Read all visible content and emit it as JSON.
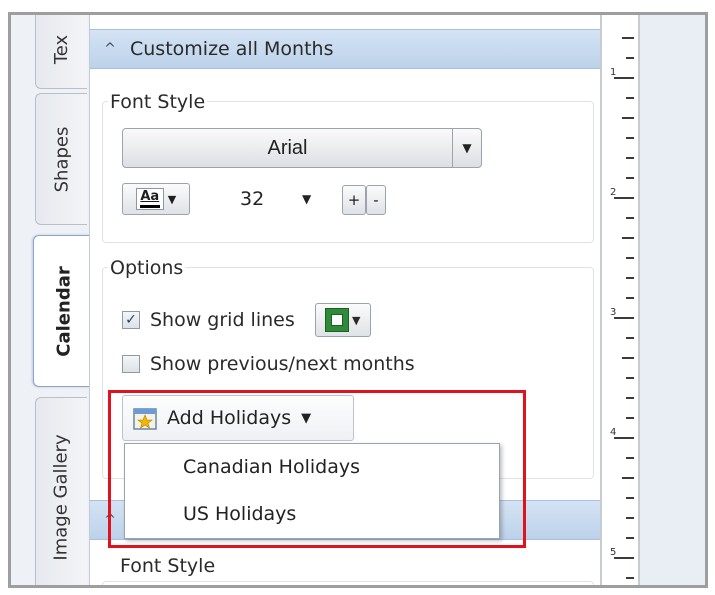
{
  "tabs": [
    {
      "label": "Tex"
    },
    {
      "label": "Shapes"
    },
    {
      "label": "Calendar"
    },
    {
      "label": "Image Gallery"
    }
  ],
  "section_customize": {
    "title": "Customize all Months",
    "font_style_label": "Font Style",
    "font_name": "Arial",
    "text_color_icon_label": "Aa",
    "font_size": "32",
    "increase_label": "+",
    "decrease_label": "-"
  },
  "options": {
    "label": "Options",
    "show_grid_lines": {
      "label": "Show grid lines",
      "checked": true
    },
    "show_prev_next": {
      "label": "Show previous/next months",
      "checked": false
    }
  },
  "holidays": {
    "button_label": "Add Holidays",
    "menu_items": [
      "Canadian Holidays",
      "US Holidays"
    ]
  },
  "section_lower": {
    "font_style_label": "Font Style"
  },
  "ruler": {
    "labels": [
      "1",
      "2",
      "3",
      "4",
      "5"
    ]
  },
  "colors": {
    "accent_header": "#c9dbef",
    "highlight_box": "#e0121b",
    "grid_color": "#2e8b3a"
  }
}
